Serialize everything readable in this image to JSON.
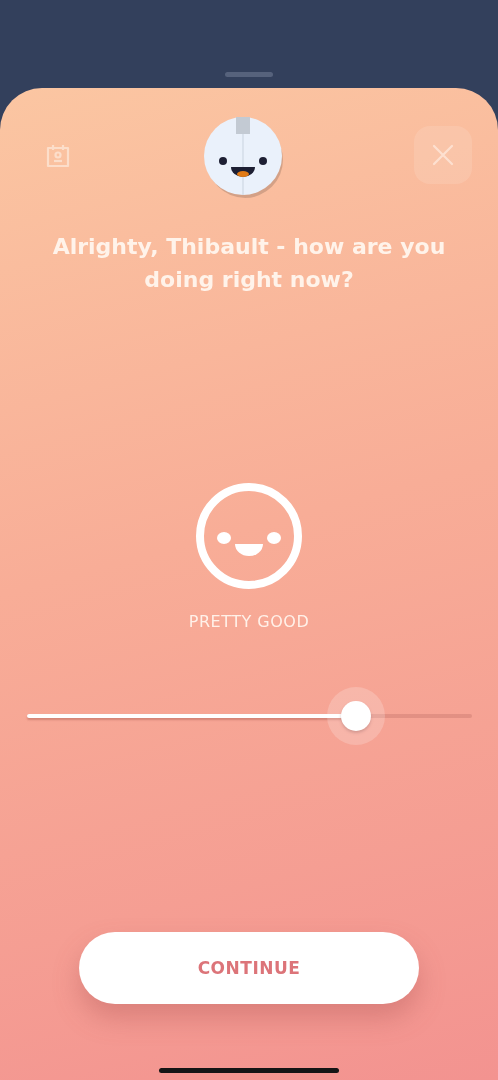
{
  "header": {
    "title": "Alrighty, Thibault - how are you doing right now?"
  },
  "mood": {
    "label": "PRETTY GOOD"
  },
  "slider": {
    "level": 0.74
  },
  "button": {
    "label": "CONTINUE"
  }
}
